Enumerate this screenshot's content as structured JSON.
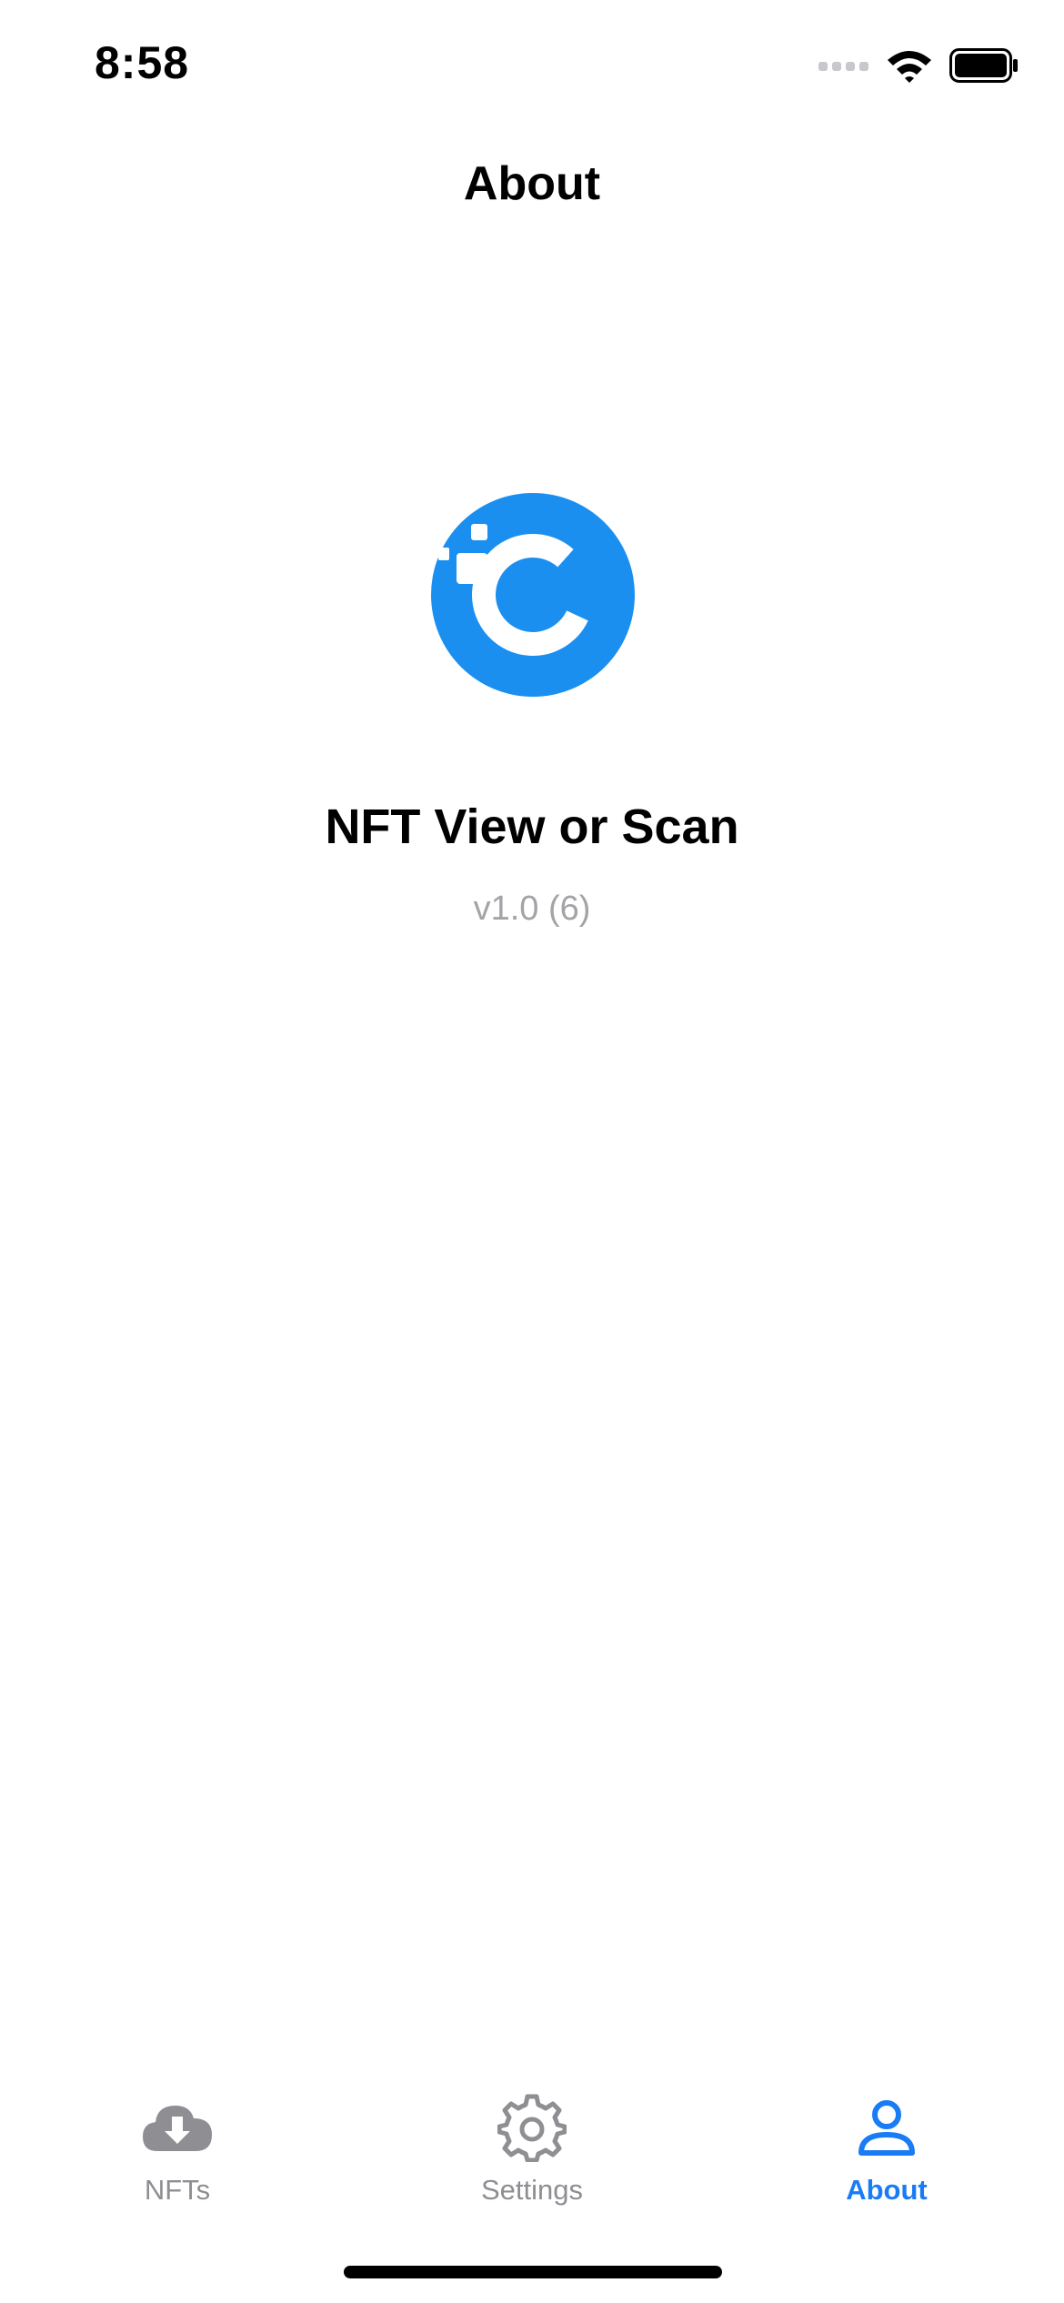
{
  "status_bar": {
    "time": "8:58",
    "icons": [
      "cellular-signal-icon",
      "wifi-icon",
      "battery-icon"
    ]
  },
  "nav": {
    "title": "About"
  },
  "app": {
    "logo": "app-logo-icon",
    "name": "NFT View or Scan",
    "version": "v1.0 (6)"
  },
  "tabs": [
    {
      "label": "NFTs",
      "icon": "cloud-download-icon",
      "active": false
    },
    {
      "label": "Settings",
      "icon": "gear-icon",
      "active": false
    },
    {
      "label": "About",
      "icon": "person-icon",
      "active": true
    }
  ],
  "colors": {
    "accent": "#1a7cf5",
    "logo": "#1b8ff0",
    "inactive": "#8e8e93",
    "version_text": "#a3a3a8"
  }
}
